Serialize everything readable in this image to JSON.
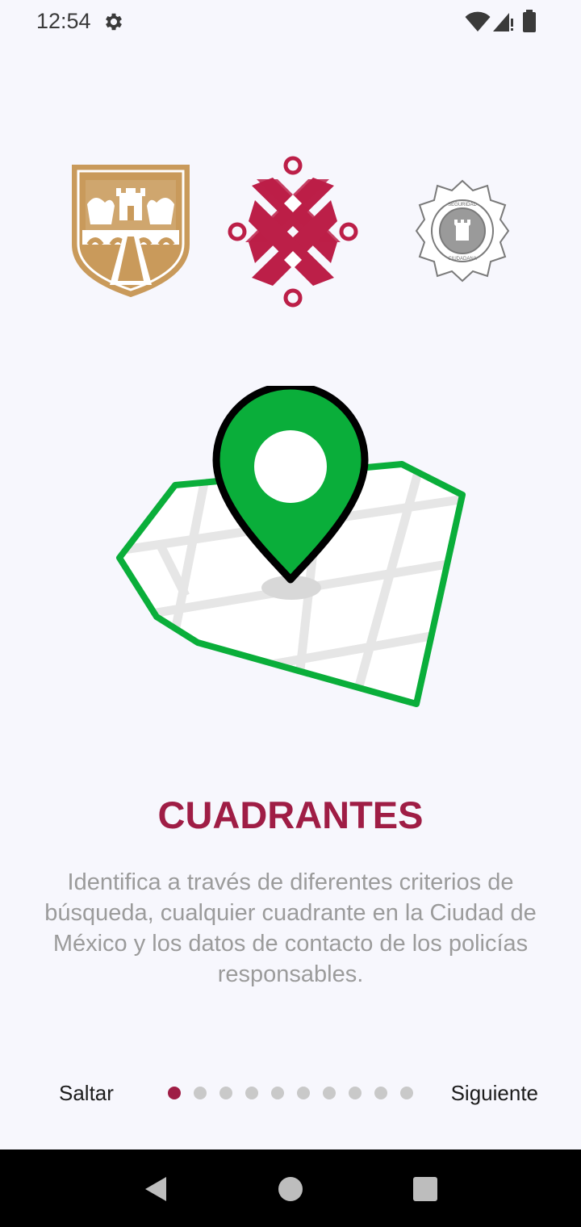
{
  "status_bar": {
    "time": "12:54",
    "icons": [
      "gear-icon",
      "wifi-icon",
      "signal-icon",
      "battery-icon"
    ]
  },
  "logos": [
    "cdmx-shield-logo",
    "ssc-emblem-logo",
    "seguridad-ciudadana-badge-logo"
  ],
  "badge_text": {
    "top": "SEGURIDAD",
    "bottom": "CIUDADANA"
  },
  "illustration": "map-pin-quadrant-icon",
  "slide": {
    "title": "CUADRANTES",
    "description": "Identifica a través de diferentes criterios de búsqueda, cualquier cuadrante en la Ciudad de México y los datos de contacto de los policías responsables."
  },
  "pager": {
    "skip_label": "Saltar",
    "next_label": "Siguiente",
    "total_pages": 10,
    "current_page": 1
  },
  "colors": {
    "accent": "#9f1d45",
    "map_green": "#0aae3a",
    "gold": "#c99a5b",
    "text_gray": "#9b9b9b"
  },
  "nav_bar": [
    "back-icon",
    "home-icon",
    "recents-icon"
  ]
}
